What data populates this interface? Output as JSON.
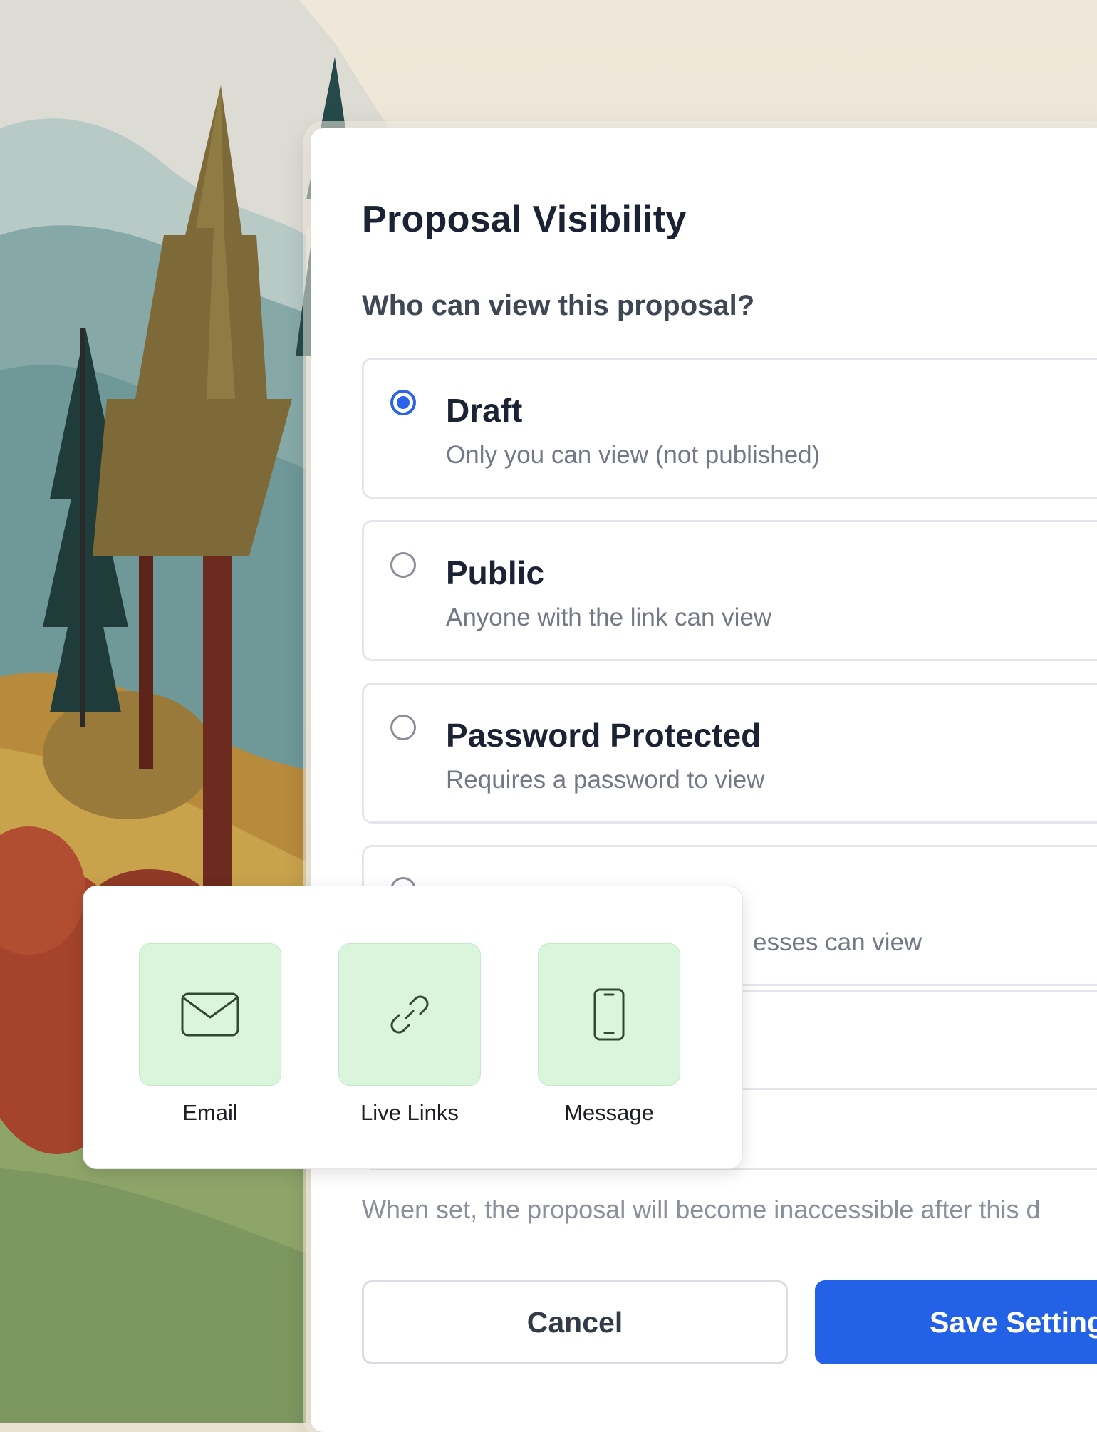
{
  "modal": {
    "title": "Proposal Visibility",
    "question": "Who can view this proposal?",
    "options": [
      {
        "title": "Draft",
        "description": "Only you can view (not published)",
        "selected": true
      },
      {
        "title": "Public",
        "description": "Anyone with the link can view",
        "selected": false
      },
      {
        "title": "Password Protected",
        "description": "Requires a password to view",
        "selected": false
      },
      {
        "title": "",
        "description": "esses can view",
        "selected": false
      }
    ],
    "expiry_hint": "When set, the proposal will become inaccessible after this d",
    "cancel_label": "Cancel",
    "save_label": "Save Setting"
  },
  "share": {
    "items": [
      {
        "label": "Email",
        "icon": "envelope-icon"
      },
      {
        "label": "Live Links",
        "icon": "link-icon"
      },
      {
        "label": "Message",
        "icon": "phone-icon"
      }
    ]
  },
  "colors": {
    "accent": "#2362e6",
    "share_tile": "#d9f5dc",
    "share_icon": "#2f4a33"
  }
}
